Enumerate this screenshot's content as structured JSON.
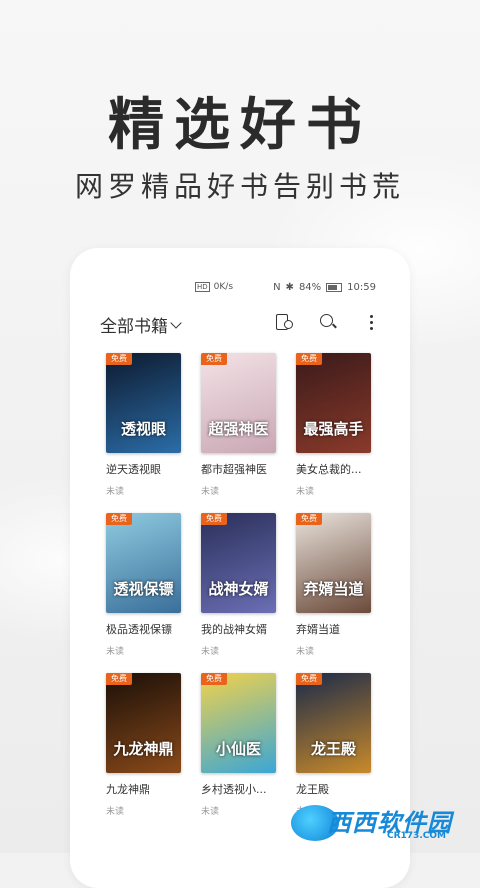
{
  "hero": {
    "title": "精选好书",
    "subtitle": "网罗精品好书告别书荒"
  },
  "status_bar": {
    "signal_left": "HD",
    "speed": "0K/s",
    "nfc": "N",
    "bluetooth": "✱",
    "battery": "84%",
    "time": "10:59"
  },
  "toolbar": {
    "title": "全部书籍",
    "icons": [
      "bookshelf-manage-icon",
      "search-icon",
      "more-icon"
    ]
  },
  "books": [
    {
      "name": "逆天透视眼",
      "status": "未读",
      "tag": "免费",
      "cover_text": "透视眼",
      "colors": [
        "#0d1a2e",
        "#2b6da8"
      ]
    },
    {
      "name": "都市超强神医",
      "status": "未读",
      "tag": "免费",
      "cover_text": "超强神医",
      "colors": [
        "#f3e2e6",
        "#c9a7b4"
      ]
    },
    {
      "name": "美女总裁的...",
      "status": "未读",
      "tag": "免费",
      "cover_text": "最强高手",
      "colors": [
        "#3a1a1a",
        "#8a3a2a"
      ]
    },
    {
      "name": "极品透视保镖",
      "status": "未读",
      "tag": "免费",
      "cover_text": "透视保镖",
      "colors": [
        "#8fcbe0",
        "#3a6f9a"
      ]
    },
    {
      "name": "我的战神女婿",
      "status": "未读",
      "tag": "免费",
      "cover_text": "战神女婿",
      "colors": [
        "#2a2f5a",
        "#6b6fb5"
      ]
    },
    {
      "name": "弃婿当道",
      "status": "未读",
      "tag": "免费",
      "cover_text": "弃婿当道",
      "colors": [
        "#e9e3dc",
        "#6b4a3a"
      ]
    },
    {
      "name": "九龙神鼎",
      "status": "未读",
      "tag": "免费",
      "cover_text": "九龙神鼎",
      "colors": [
        "#1a0f08",
        "#8a4a1a"
      ]
    },
    {
      "name": "乡村透视小...",
      "status": "未读",
      "tag": "免费",
      "cover_text": "小仙医",
      "colors": [
        "#f3d24a",
        "#3aa6d6"
      ]
    },
    {
      "name": "龙王殿",
      "status": "未读",
      "tag": "免费",
      "cover_text": "龙王殿",
      "colors": [
        "#1a2a4a",
        "#c98a2a"
      ]
    }
  ],
  "watermark": {
    "text": "西西软件园",
    "url": "CR173.COM"
  }
}
